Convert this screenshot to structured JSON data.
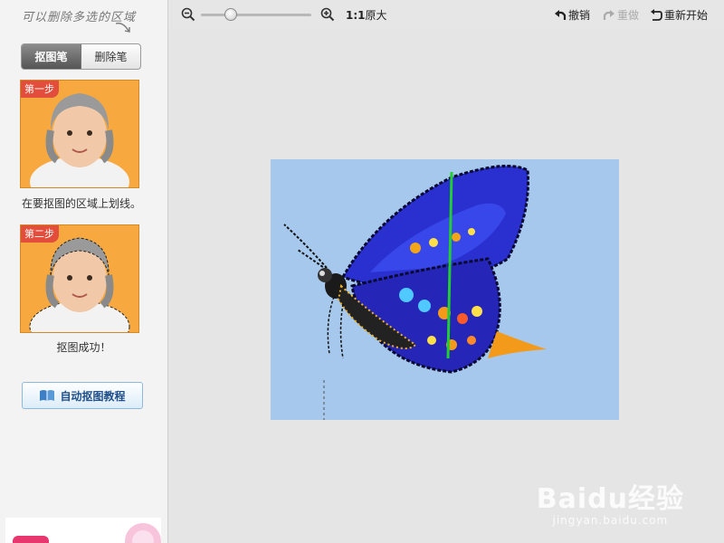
{
  "sidebar": {
    "hint": "可以删除多选的区域",
    "pen_modes": [
      {
        "label": "抠图笔",
        "active": true
      },
      {
        "label": "删除笔",
        "active": false
      }
    ],
    "steps": [
      {
        "badge": "第一步",
        "caption": "在要抠图的区域上划线。"
      },
      {
        "badge": "第二步",
        "caption": "抠图成功！"
      }
    ],
    "tutorial_button": "自动抠图教程"
  },
  "toolbar": {
    "zoom_ratio": "1:1",
    "zoom_ratio_label": "原大",
    "zoom_level": 0.24,
    "undo": "撤销",
    "redo": "重做",
    "restart": "重新开始"
  },
  "canvas": {
    "image_label": "蝴蝶",
    "watermark_main": "Baidu经验",
    "watermark_sub": "jingyan.baidu.com"
  },
  "colors": {
    "accent_stroke": "#22cc33",
    "wing_blue": "#2a2fd0",
    "image_bg": "#a6c8ec",
    "step_badge": "#e34d3c"
  }
}
